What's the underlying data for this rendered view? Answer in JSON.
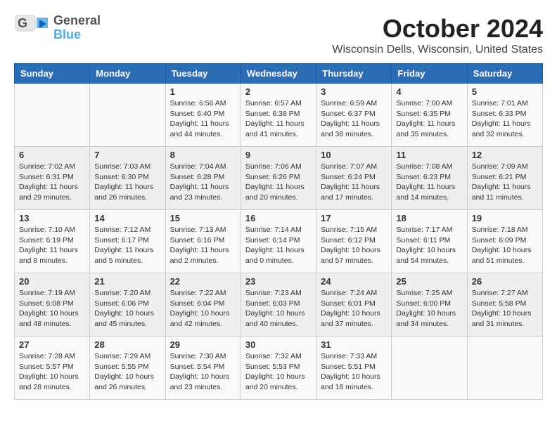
{
  "header": {
    "logo": {
      "general": "General",
      "blue": "Blue"
    },
    "title": "October 2024",
    "subtitle": "Wisconsin Dells, Wisconsin, United States"
  },
  "weekdays": [
    "Sunday",
    "Monday",
    "Tuesday",
    "Wednesday",
    "Thursday",
    "Friday",
    "Saturday"
  ],
  "weeks": [
    [
      {
        "day": "",
        "info": ""
      },
      {
        "day": "",
        "info": ""
      },
      {
        "day": "1",
        "info": "Sunrise: 6:56 AM\nSunset: 6:40 PM\nDaylight: 11 hours and 44 minutes."
      },
      {
        "day": "2",
        "info": "Sunrise: 6:57 AM\nSunset: 6:38 PM\nDaylight: 11 hours and 41 minutes."
      },
      {
        "day": "3",
        "info": "Sunrise: 6:59 AM\nSunset: 6:37 PM\nDaylight: 11 hours and 38 minutes."
      },
      {
        "day": "4",
        "info": "Sunrise: 7:00 AM\nSunset: 6:35 PM\nDaylight: 11 hours and 35 minutes."
      },
      {
        "day": "5",
        "info": "Sunrise: 7:01 AM\nSunset: 6:33 PM\nDaylight: 11 hours and 32 minutes."
      }
    ],
    [
      {
        "day": "6",
        "info": "Sunrise: 7:02 AM\nSunset: 6:31 PM\nDaylight: 11 hours and 29 minutes."
      },
      {
        "day": "7",
        "info": "Sunrise: 7:03 AM\nSunset: 6:30 PM\nDaylight: 11 hours and 26 minutes."
      },
      {
        "day": "8",
        "info": "Sunrise: 7:04 AM\nSunset: 6:28 PM\nDaylight: 11 hours and 23 minutes."
      },
      {
        "day": "9",
        "info": "Sunrise: 7:06 AM\nSunset: 6:26 PM\nDaylight: 11 hours and 20 minutes."
      },
      {
        "day": "10",
        "info": "Sunrise: 7:07 AM\nSunset: 6:24 PM\nDaylight: 11 hours and 17 minutes."
      },
      {
        "day": "11",
        "info": "Sunrise: 7:08 AM\nSunset: 6:23 PM\nDaylight: 11 hours and 14 minutes."
      },
      {
        "day": "12",
        "info": "Sunrise: 7:09 AM\nSunset: 6:21 PM\nDaylight: 11 hours and 11 minutes."
      }
    ],
    [
      {
        "day": "13",
        "info": "Sunrise: 7:10 AM\nSunset: 6:19 PM\nDaylight: 11 hours and 8 minutes."
      },
      {
        "day": "14",
        "info": "Sunrise: 7:12 AM\nSunset: 6:17 PM\nDaylight: 11 hours and 5 minutes."
      },
      {
        "day": "15",
        "info": "Sunrise: 7:13 AM\nSunset: 6:16 PM\nDaylight: 11 hours and 2 minutes."
      },
      {
        "day": "16",
        "info": "Sunrise: 7:14 AM\nSunset: 6:14 PM\nDaylight: 11 hours and 0 minutes."
      },
      {
        "day": "17",
        "info": "Sunrise: 7:15 AM\nSunset: 6:12 PM\nDaylight: 10 hours and 57 minutes."
      },
      {
        "day": "18",
        "info": "Sunrise: 7:17 AM\nSunset: 6:11 PM\nDaylight: 10 hours and 54 minutes."
      },
      {
        "day": "19",
        "info": "Sunrise: 7:18 AM\nSunset: 6:09 PM\nDaylight: 10 hours and 51 minutes."
      }
    ],
    [
      {
        "day": "20",
        "info": "Sunrise: 7:19 AM\nSunset: 6:08 PM\nDaylight: 10 hours and 48 minutes."
      },
      {
        "day": "21",
        "info": "Sunrise: 7:20 AM\nSunset: 6:06 PM\nDaylight: 10 hours and 45 minutes."
      },
      {
        "day": "22",
        "info": "Sunrise: 7:22 AM\nSunset: 6:04 PM\nDaylight: 10 hours and 42 minutes."
      },
      {
        "day": "23",
        "info": "Sunrise: 7:23 AM\nSunset: 6:03 PM\nDaylight: 10 hours and 40 minutes."
      },
      {
        "day": "24",
        "info": "Sunrise: 7:24 AM\nSunset: 6:01 PM\nDaylight: 10 hours and 37 minutes."
      },
      {
        "day": "25",
        "info": "Sunrise: 7:25 AM\nSunset: 6:00 PM\nDaylight: 10 hours and 34 minutes."
      },
      {
        "day": "26",
        "info": "Sunrise: 7:27 AM\nSunset: 5:58 PM\nDaylight: 10 hours and 31 minutes."
      }
    ],
    [
      {
        "day": "27",
        "info": "Sunrise: 7:28 AM\nSunset: 5:57 PM\nDaylight: 10 hours and 28 minutes."
      },
      {
        "day": "28",
        "info": "Sunrise: 7:29 AM\nSunset: 5:55 PM\nDaylight: 10 hours and 26 minutes."
      },
      {
        "day": "29",
        "info": "Sunrise: 7:30 AM\nSunset: 5:54 PM\nDaylight: 10 hours and 23 minutes."
      },
      {
        "day": "30",
        "info": "Sunrise: 7:32 AM\nSunset: 5:53 PM\nDaylight: 10 hours and 20 minutes."
      },
      {
        "day": "31",
        "info": "Sunrise: 7:33 AM\nSunset: 5:51 PM\nDaylight: 10 hours and 18 minutes."
      },
      {
        "day": "",
        "info": ""
      },
      {
        "day": "",
        "info": ""
      }
    ]
  ]
}
